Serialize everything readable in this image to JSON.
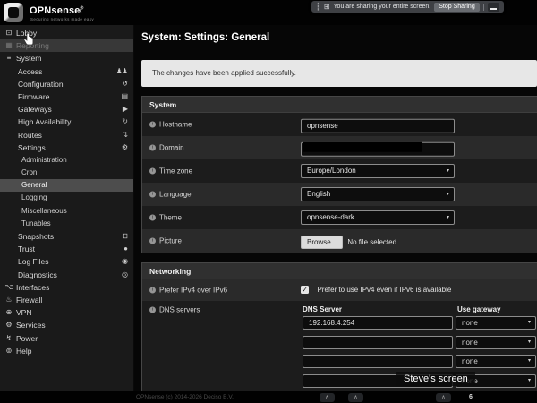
{
  "share_bar": {
    "message": "You are sharing your entire screen.",
    "stop_button": "Stop Sharing"
  },
  "brand": {
    "name": "OPNsense",
    "registered": "®",
    "tagline": "Securing networks made easy",
    "collapse_icon": "‹"
  },
  "sidebar": {
    "items": [
      {
        "label": "Lobby",
        "icon": "dashboard",
        "level": 0
      },
      {
        "label": "Reporting",
        "icon": "chart",
        "level": 0,
        "state": "hovered"
      },
      {
        "label": "System",
        "icon": "menu",
        "level": 0
      },
      {
        "label": "Access",
        "icon": "users",
        "iconSide": "right",
        "level": 1
      },
      {
        "label": "Configuration",
        "icon": "history",
        "iconSide": "right",
        "level": 1
      },
      {
        "label": "Firmware",
        "icon": "save",
        "iconSide": "right",
        "level": 1
      },
      {
        "label": "Gateways",
        "icon": "location-arrow",
        "iconSide": "right",
        "level": 1
      },
      {
        "label": "High Availability",
        "icon": "refresh",
        "iconSide": "right",
        "level": 1
      },
      {
        "label": "Routes",
        "icon": "road",
        "iconSide": "right",
        "level": 1
      },
      {
        "label": "Settings",
        "icon": "cogs",
        "iconSide": "right",
        "level": 1
      },
      {
        "label": "Administration",
        "level": 2
      },
      {
        "label": "Cron",
        "level": 2
      },
      {
        "label": "General",
        "level": 2,
        "state": "active"
      },
      {
        "label": "Logging",
        "level": 2
      },
      {
        "label": "Miscellaneous",
        "level": 2
      },
      {
        "label": "Tunables",
        "level": 2
      },
      {
        "label": "Snapshots",
        "icon": "hdd",
        "iconSide": "right",
        "level": 1
      },
      {
        "label": "Trust",
        "icon": "certificate",
        "iconSide": "right",
        "level": 1
      },
      {
        "label": "Log Files",
        "icon": "eye",
        "iconSide": "right",
        "level": 1
      },
      {
        "label": "Diagnostics",
        "icon": "diagnostics",
        "iconSide": "right",
        "level": 1
      },
      {
        "label": "Interfaces",
        "icon": "sitemap",
        "level": 0
      },
      {
        "label": "Firewall",
        "icon": "fire",
        "level": 0
      },
      {
        "label": "VPN",
        "icon": "globe",
        "level": 0
      },
      {
        "label": "Services",
        "icon": "gear",
        "level": 0
      },
      {
        "label": "Power",
        "icon": "power",
        "level": 0
      },
      {
        "label": "Help",
        "icon": "help",
        "level": 0
      }
    ]
  },
  "page": {
    "title": "System: Settings: General"
  },
  "alert": {
    "text": "The changes have been applied successfully."
  },
  "form": {
    "system": {
      "title": "System",
      "fields": [
        {
          "label": "Hostname",
          "type": "text",
          "value": "opnsense",
          "shade": "dark"
        },
        {
          "label": "Domain",
          "type": "redacted",
          "value": "",
          "shade": "light"
        },
        {
          "label": "Time zone",
          "type": "select",
          "value": "Europe/London",
          "shade": "dark"
        },
        {
          "label": "Language",
          "type": "select",
          "value": "English",
          "shade": "light"
        },
        {
          "label": "Theme",
          "type": "select",
          "value": "opnsense-dark",
          "shade": "dark"
        },
        {
          "label": "Picture",
          "type": "file",
          "button": "Browse...",
          "note": "No file selected.",
          "shade": "light"
        }
      ]
    },
    "networking": {
      "title": "Networking",
      "prefer_ipv4": {
        "label": "Prefer IPv4 over IPv6",
        "checkbox_label": "Prefer to use IPv4 even if IPv6 is available",
        "checked": true
      },
      "dns": {
        "label": "DNS servers",
        "columns": [
          "DNS Server",
          "Use gateway"
        ],
        "rows": [
          {
            "server": "192.168.4.254",
            "gateway": "none"
          },
          {
            "server": "",
            "gateway": "none"
          },
          {
            "server": "",
            "gateway": "none"
          },
          {
            "server": "",
            "gateway": "none"
          }
        ]
      }
    }
  },
  "overlay": {
    "screen_label": "Steve's screen"
  },
  "footer": {
    "copyright": "OPNsense (c) 2014-2026 Deciso B.V.",
    "badge": "6"
  },
  "colors": {
    "theme_bg": "#1a1a1a",
    "alert_bg": "#e7e7e7",
    "section_header_bg": "#303030"
  }
}
